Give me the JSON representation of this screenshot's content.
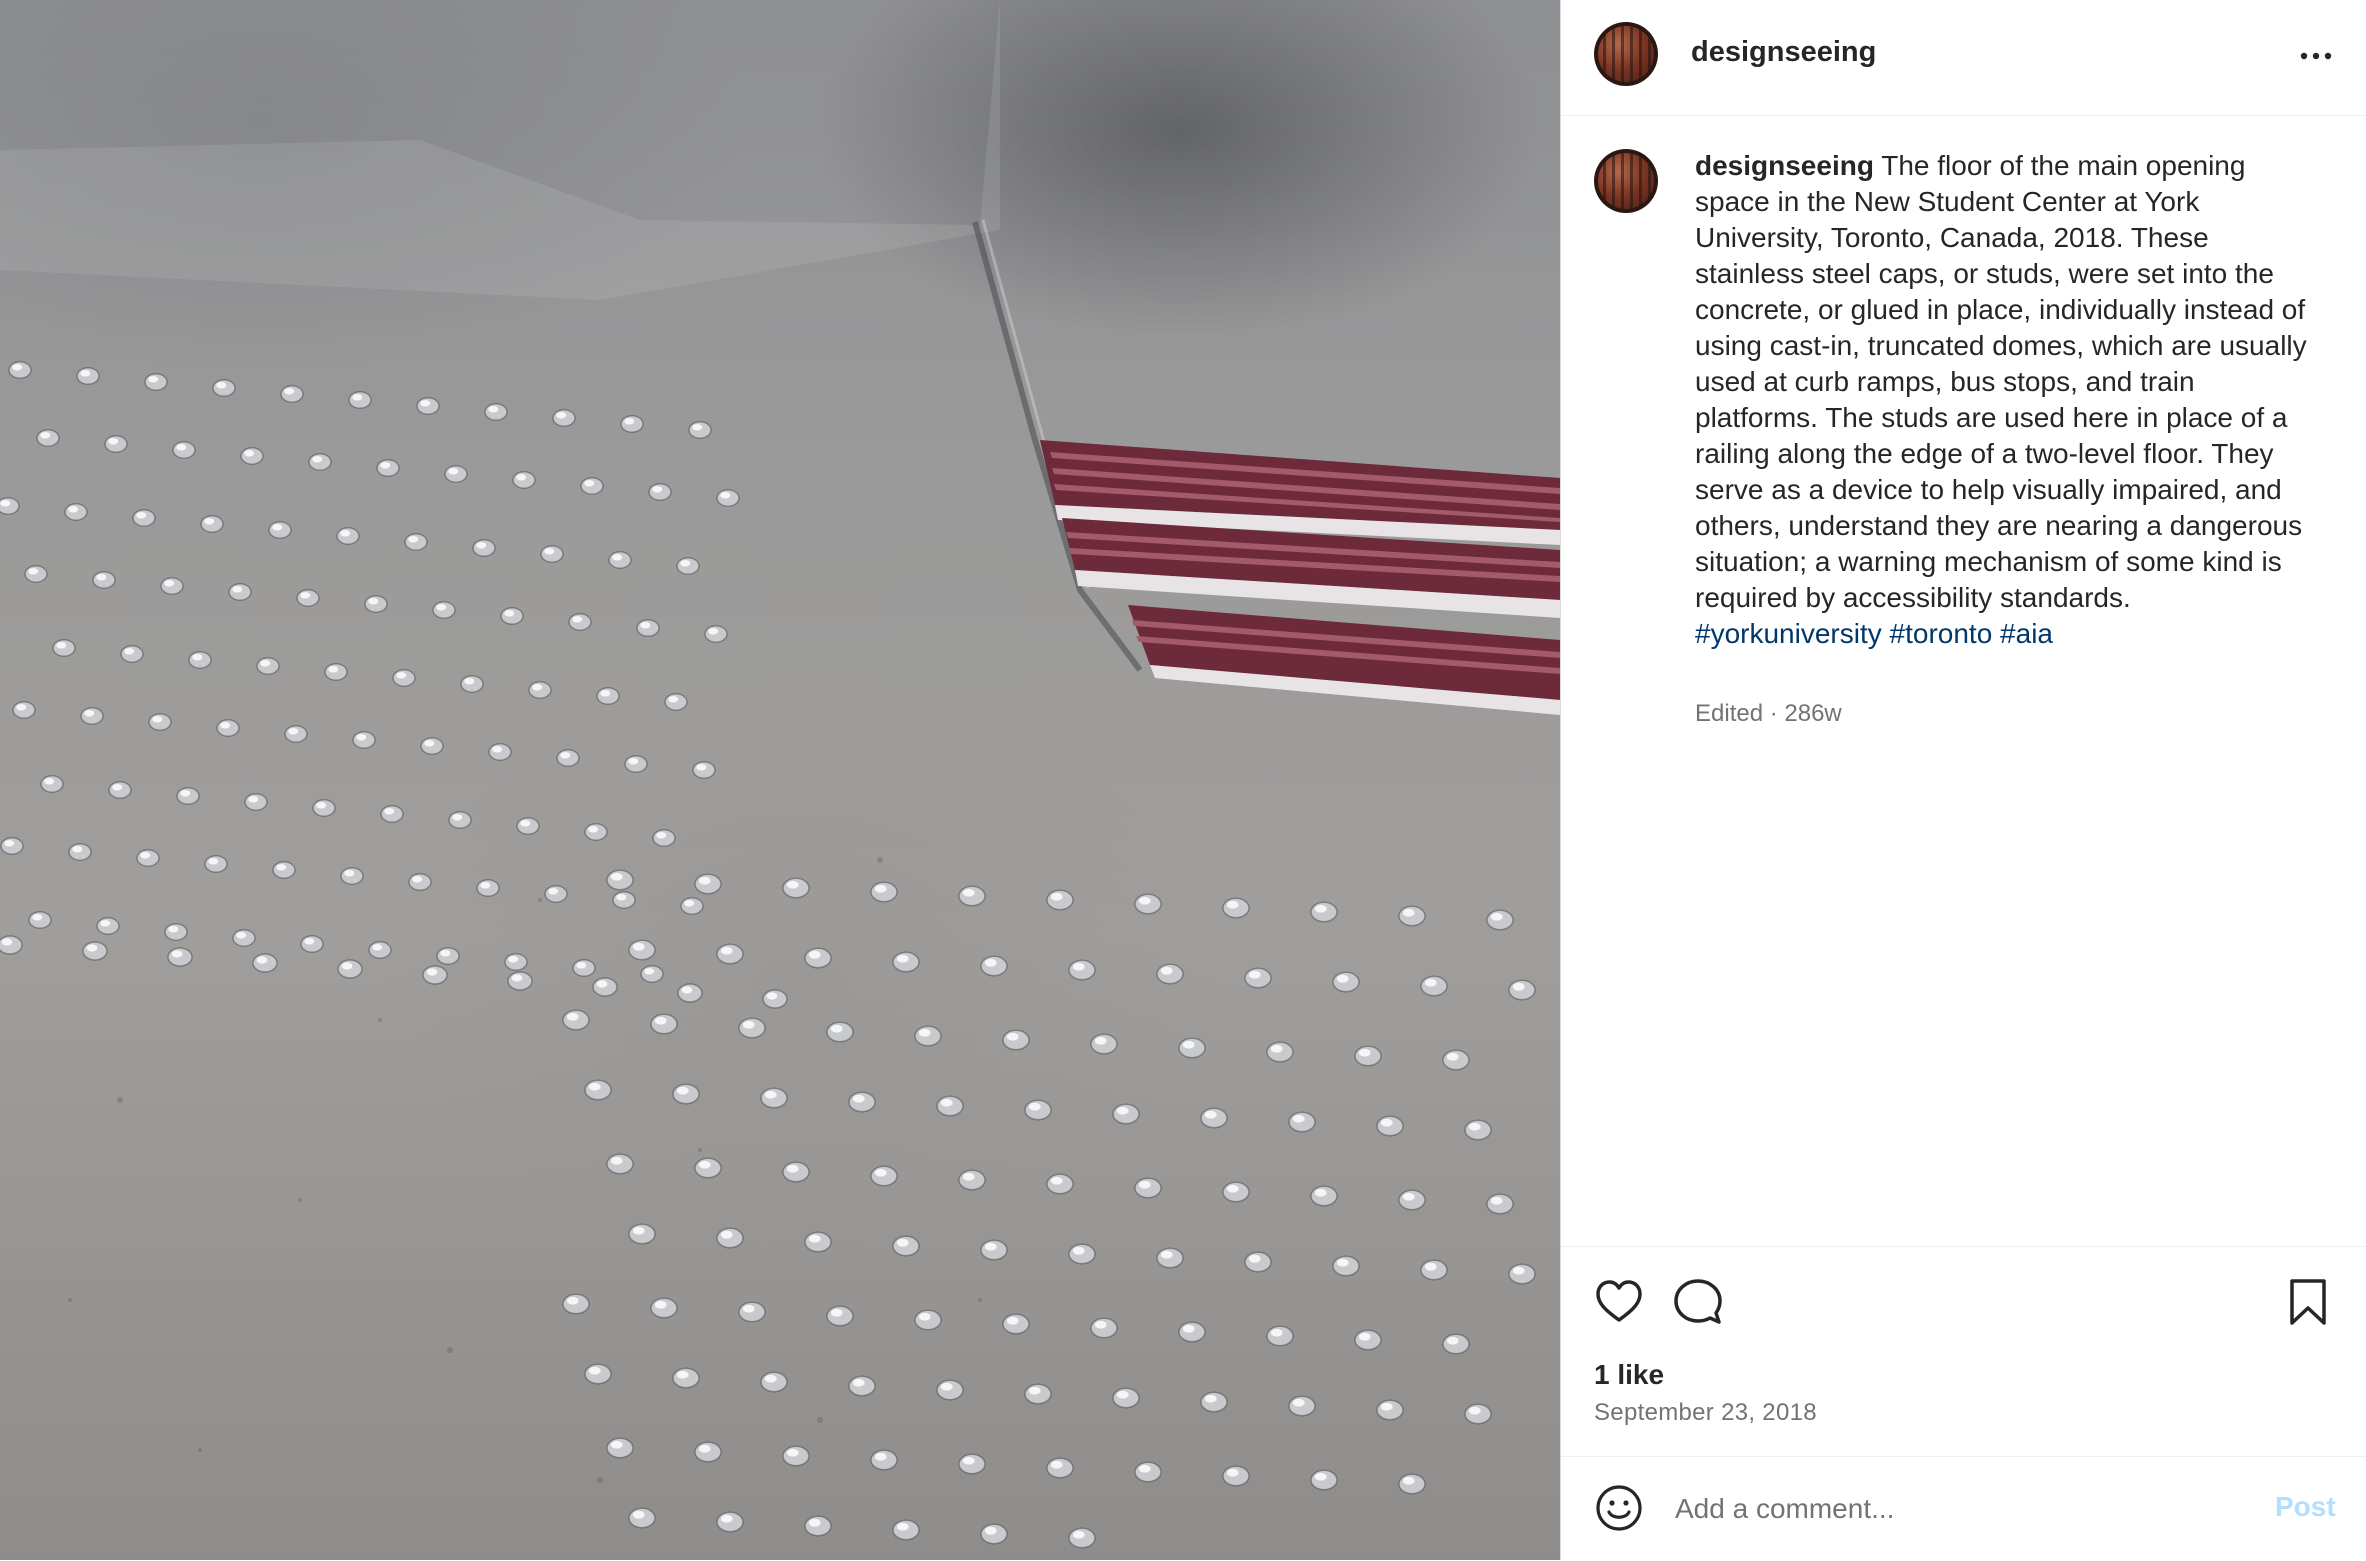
{
  "post": {
    "photo_description": "concrete-floor-with-steel-studs",
    "username": "designseeing",
    "caption": {
      "username": "designseeing",
      "text": "The floor of the main opening space in the New Student Center at York University, Toronto, Canada, 2018. These stainless steel caps, or studs, were set into the concrete, or glued in place, individually instead of using cast-in, truncated domes, which are usually used at curb ramps, bus stops, and train platforms. The studs are used here in place of a railing along the edge of a two-level floor. They serve as a device to help visually impaired, and others, understand they are nearing a dangerous situation; a warning mechanism of some kind is required by accessibility standards.",
      "hashtags": [
        "#yorkuniversity",
        "#toronto",
        "#aia"
      ],
      "meta": "Edited · 286w"
    },
    "likes": "1 like",
    "date": "September 23, 2018"
  },
  "comment": {
    "placeholder": "Add a comment...",
    "post_label": "Post"
  },
  "icons": {
    "more": "more-options-icon",
    "like": "heart-icon",
    "comment": "comment-bubble-icon",
    "save": "bookmark-icon",
    "emoji": "emoji-icon"
  },
  "colors": {
    "hashtag": "#00376b",
    "secondary_text": "#737373",
    "post_button_disabled": "#b2dffc",
    "divider": "#efefef"
  }
}
